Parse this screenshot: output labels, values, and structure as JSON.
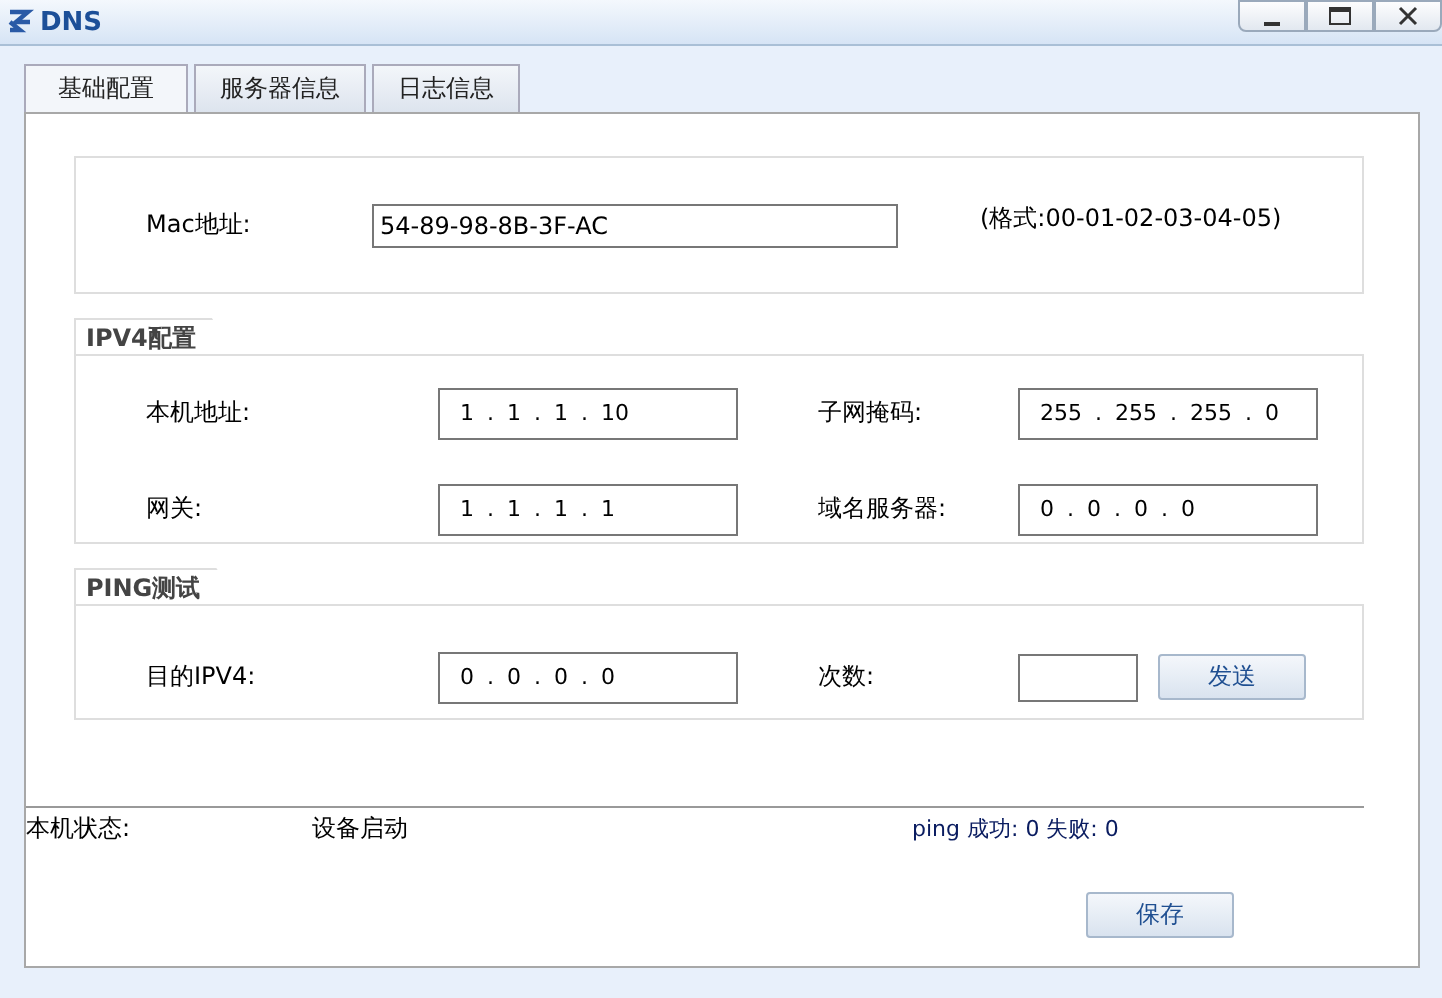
{
  "window": {
    "title": "DNS"
  },
  "tabs": [
    {
      "label": "基础配置",
      "selected": true
    },
    {
      "label": "服务器信息",
      "selected": false
    },
    {
      "label": "日志信息",
      "selected": false
    }
  ],
  "mac": {
    "label": "Mac地址:",
    "value": "54-89-98-8B-3F-AC",
    "hint": "(格式:00-01-02-03-04-05)"
  },
  "ipv4": {
    "title": "IPV4配置",
    "fields": [
      {
        "label": "本机地址:",
        "value": "1 . 1 . 1 . 10"
      },
      {
        "label": "子网掩码:",
        "value": "255 . 255 . 255 . 0"
      },
      {
        "label": "网关:",
        "value": "1 . 1 . 1 . 1"
      },
      {
        "label": "域名服务器:",
        "value": "0 . 0 . 0 . 0"
      }
    ]
  },
  "ping": {
    "title": "PING测试",
    "target_label": "目的IPV4:",
    "target_value": "0 . 0 . 0 . 0",
    "count_label": "次数:",
    "send_button": "发送"
  },
  "status": {
    "label": "本机状态:",
    "value": "设备启动",
    "ping_result": "ping 成功: 0 失败: 0"
  },
  "save_button": "保存"
}
